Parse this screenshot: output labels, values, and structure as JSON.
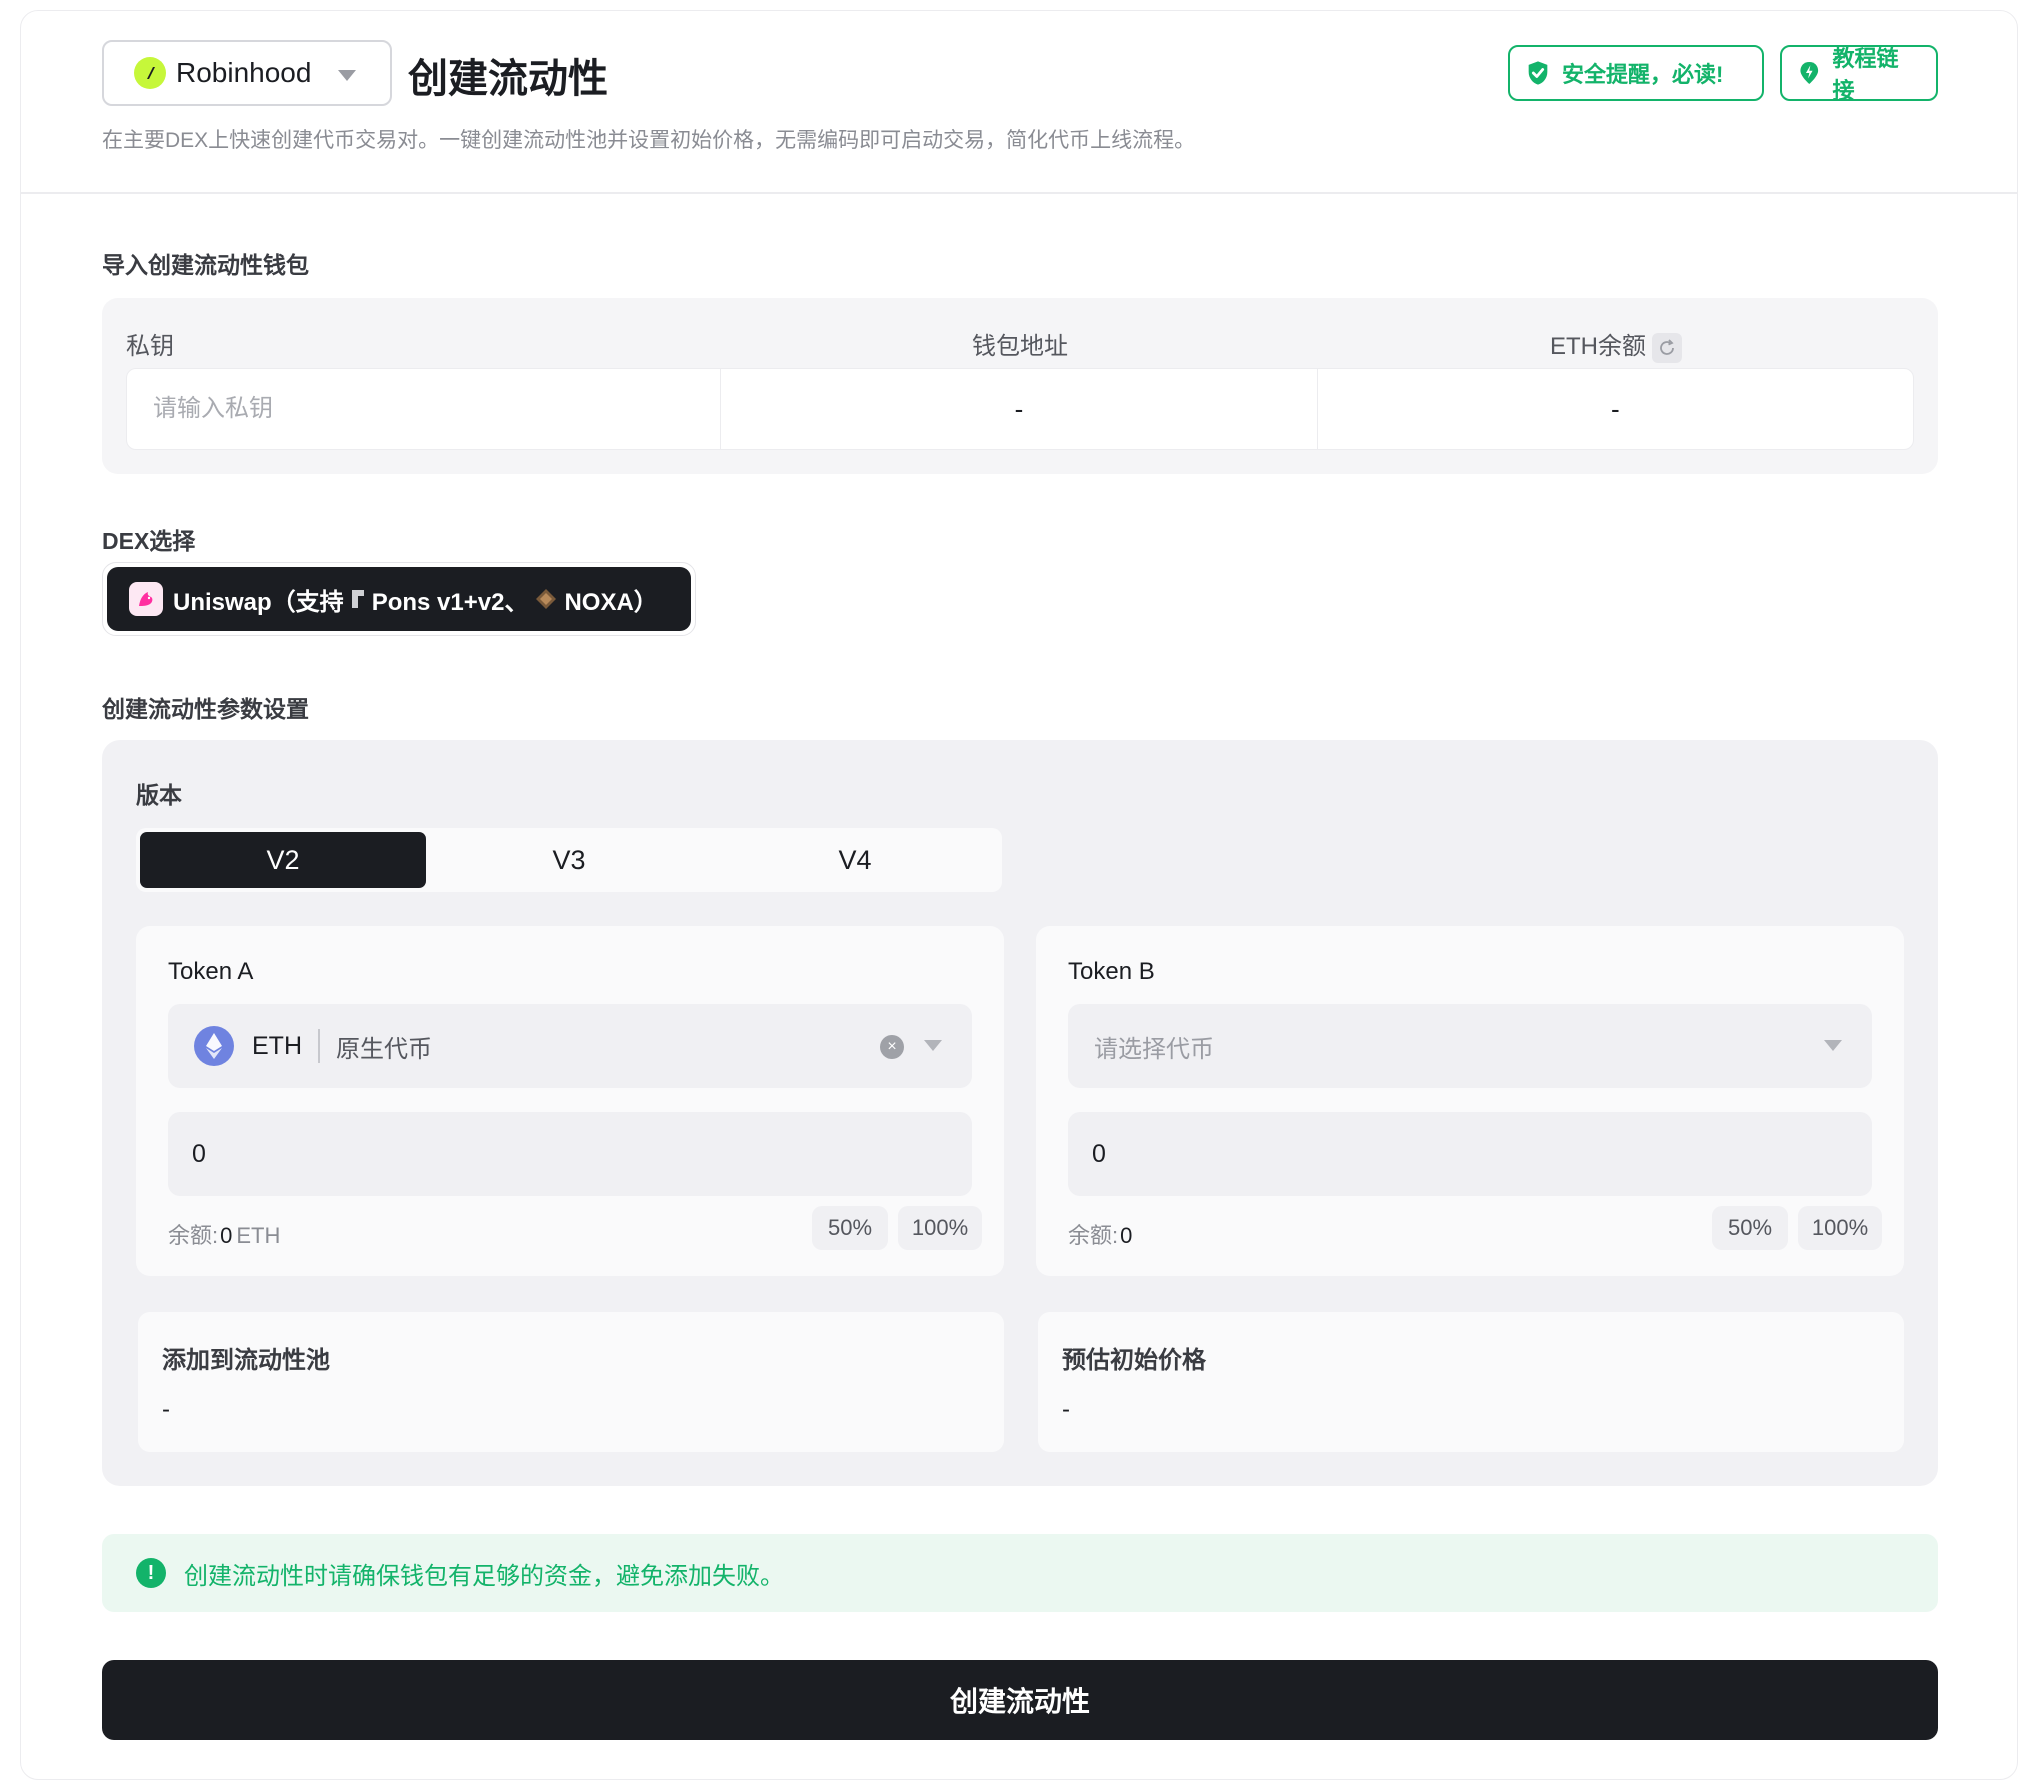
{
  "header": {
    "chain": "Robinhood",
    "title": "创建流动性",
    "description": "在主要DEX上快速创建代币交易对。一键创建流动性池并设置初始价格，无需编码即可启动交易，简化代币上线流程。",
    "safety_button": "安全提醒，必读!",
    "tutorial_button": "教程链接"
  },
  "wallet": {
    "section_title": "导入创建流动性钱包",
    "col_private_key": "私钥",
    "col_address": "钱包地址",
    "col_balance": "ETH余额",
    "private_key_placeholder": "请输入私钥",
    "address_value": "-",
    "balance_value": "-"
  },
  "dex": {
    "section_title": "DEX选择",
    "name_prefix": "Uniswap（支持",
    "pons": "Pons v1+v2、",
    "noxa": "NOXA）"
  },
  "params": {
    "section_title": "创建流动性参数设置",
    "version_label": "版本",
    "tabs": [
      "V2",
      "V3",
      "V4"
    ],
    "active_tab": "V2",
    "token_a": {
      "label": "Token A",
      "symbol": "ETH",
      "name": "原生代币",
      "amount": "0",
      "balance_label": "余额:",
      "balance_value": "0",
      "balance_unit": "ETH",
      "pct_50": "50%",
      "pct_100": "100%"
    },
    "token_b": {
      "label": "Token B",
      "placeholder": "请选择代币",
      "amount": "0",
      "balance_label": "余额:",
      "balance_value": "0",
      "pct_50": "50%",
      "pct_100": "100%"
    },
    "add_to_pool": {
      "title": "添加到流动性池",
      "value": "-"
    },
    "initial_price": {
      "title": "预估初始价格",
      "value": "-"
    }
  },
  "notice": "创建流动性时请确保钱包有足够的资金，避免添加失败。",
  "submit_label": "创建流动性",
  "colors": {
    "accent_green": "#13b36a",
    "dark": "#1b1d22",
    "chain_lime": "#c6f73a"
  }
}
